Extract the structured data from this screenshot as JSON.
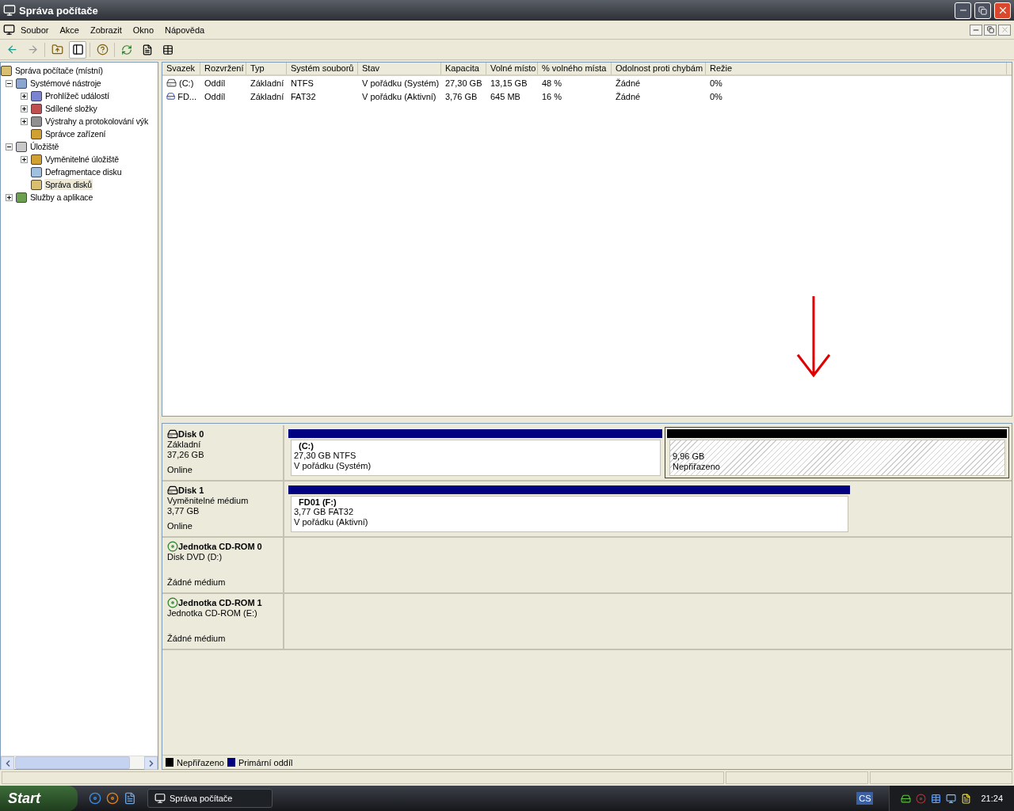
{
  "window": {
    "title": "Správa počítače"
  },
  "menu": [
    "Soubor",
    "Akce",
    "Zobrazit",
    "Okno",
    "Nápověda"
  ],
  "tree": [
    {
      "label": "Správa počítače (místní)",
      "selected": false,
      "children": [
        {
          "label": "Systémové nástroje",
          "expanded": true,
          "selected": false,
          "children": [
            {
              "label": "Prohlížeč událostí",
              "expanded": false,
              "selected": false
            },
            {
              "label": "Sdílené složky",
              "expanded": false,
              "selected": false
            },
            {
              "label": "Výstrahy a protokolování výk",
              "expanded": false,
              "selected": false
            },
            {
              "label": "Správce zařízení",
              "selected": false
            }
          ]
        },
        {
          "label": "Úložiště",
          "expanded": true,
          "selected": false,
          "children": [
            {
              "label": "Vyměnitelné úložiště",
              "expanded": false,
              "selected": false
            },
            {
              "label": "Defragmentace disku",
              "selected": false
            },
            {
              "label": "Správa disků",
              "selected": true
            }
          ]
        },
        {
          "label": "Služby a aplikace",
          "expanded": false,
          "selected": false
        }
      ]
    }
  ],
  "table": {
    "columns": [
      "Svazek",
      "Rozvržení",
      "Typ",
      "Systém souborů",
      "Stav",
      "Kapacita",
      "Volné místo",
      "% volného místa",
      "Odolnost proti chybám",
      "Režie"
    ],
    "rows": [
      [
        "(C:)",
        "Oddíl",
        "Základní",
        "NTFS",
        "V pořádku (Systém)",
        "27,30 GB",
        "13,15 GB",
        "48 %",
        "Žádné",
        "0%"
      ],
      [
        "FD...",
        "Oddíl",
        "Základní",
        "FAT32",
        "V pořádku (Aktivní)",
        "3,76 GB",
        "645 MB",
        "16 %",
        "Žádné",
        "0%"
      ]
    ]
  },
  "disks": [
    {
      "name": "Disk 0",
      "kind": "disk",
      "lines": [
        "Základní",
        "37,26 GB"
      ],
      "status": "Online",
      "partitions": [
        {
          "kind": "primary",
          "title": "(C:)",
          "lines": [
            "27,30 GB NTFS",
            "V pořádku (Systém)"
          ],
          "selected": false
        },
        {
          "kind": "unallocated",
          "lines": [
            "9,96 GB",
            "Nepřiřazeno"
          ],
          "selected": true
        }
      ]
    },
    {
      "name": "Disk 1",
      "kind": "disk",
      "lines": [
        "Vyměnitelné médium",
        "3,77 GB"
      ],
      "status": "Online",
      "partitions": [
        {
          "kind": "primary",
          "title": "FD01  (F:)",
          "lines": [
            "3,77 GB FAT32",
            "V pořádku (Aktivní)"
          ],
          "selected": false
        }
      ]
    },
    {
      "name": "Jednotka CD-ROM 0",
      "kind": "cdrom",
      "lines": [
        "Disk DVD (D:)"
      ],
      "status": "Žádné médium"
    },
    {
      "name": "Jednotka CD-ROM 1",
      "kind": "cdrom",
      "lines": [
        "Jednotka CD-ROM (E:)"
      ],
      "status": "Žádné médium"
    }
  ],
  "legend": [
    {
      "label": "Nepřiřazeno",
      "color": "#000000"
    },
    {
      "label": "Primární oddíl",
      "color": "#000080"
    }
  ],
  "taskbar": {
    "start": "Start",
    "task": "Správa počítače",
    "language": "CS",
    "clock": "21:24"
  }
}
